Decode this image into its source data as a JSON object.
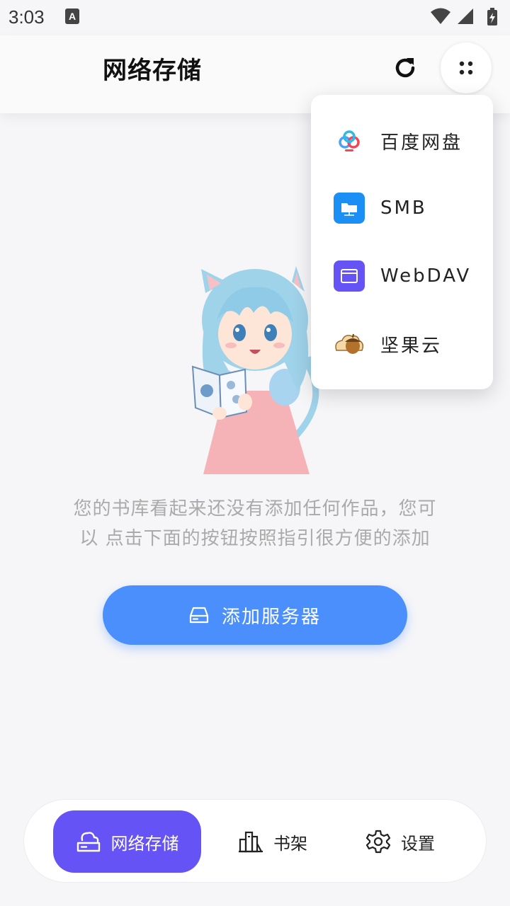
{
  "status_bar": {
    "time": "3:03",
    "notification_letter": "A"
  },
  "header": {
    "title": "网络存储",
    "refresh_icon": "refresh-icon",
    "more_icon": "dots-grid-icon"
  },
  "menu": {
    "items": [
      {
        "label": "百度网盘",
        "icon": "baidu-cloud-icon"
      },
      {
        "label": "SMB",
        "icon": "smb-folder-icon"
      },
      {
        "label": "WebDAV",
        "icon": "webdav-icon"
      },
      {
        "label": "坚果云",
        "icon": "nutstore-acorn-icon"
      }
    ]
  },
  "empty_state": {
    "line1": "您的书库看起来还没有添加任何作品，您可",
    "line2": "以 点击下面的按钮按照指引很方便的添加",
    "illustration": "cat-girl-reading-illustration"
  },
  "add_button": {
    "label": "添加服务器",
    "icon": "server-drive-icon"
  },
  "bottom_nav": {
    "items": [
      {
        "label": "网络存储",
        "icon": "cloud-drive-icon",
        "active": true
      },
      {
        "label": "书架",
        "icon": "bookshelf-icon",
        "active": false
      },
      {
        "label": "设置",
        "icon": "gear-icon",
        "active": false
      }
    ]
  },
  "colors": {
    "accent_purple": "#6553f6",
    "button_blue": "#4a8ffb",
    "background": "#f6f6f8",
    "hint_text": "#aaaaaa"
  }
}
